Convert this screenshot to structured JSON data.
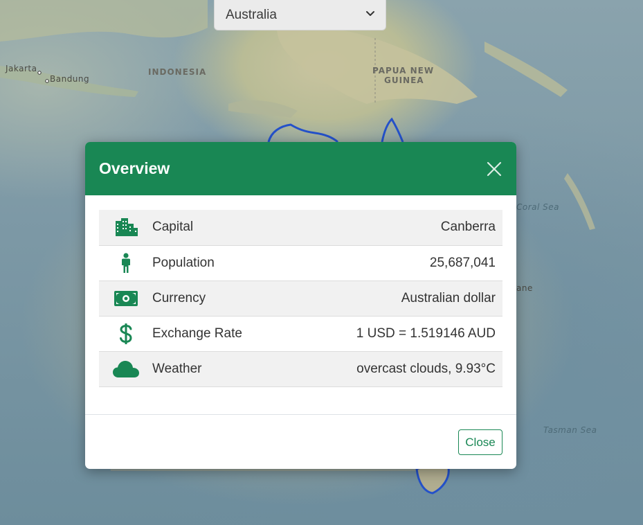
{
  "country_select": {
    "value": "Australia",
    "icon": "chevron-down-icon"
  },
  "map": {
    "labels": {
      "jakarta": "Jakarta",
      "bandung": "Bandung",
      "indonesia": "INDONESIA",
      "papua_line1": "PAPUA NEW",
      "papua_line2": "GUINEA",
      "coral_sea": "Coral Sea",
      "brisbane_partial": "ane",
      "tasman_sea": "Tasman Sea"
    }
  },
  "modal": {
    "title": "Overview",
    "close_icon": "close-icon",
    "rows": [
      {
        "icon": "city-icon",
        "label": "Capital",
        "value": "Canberra"
      },
      {
        "icon": "person-icon",
        "label": "Population",
        "value": "25,687,041"
      },
      {
        "icon": "banknote-icon",
        "label": "Currency",
        "value": "Australian dollar"
      },
      {
        "icon": "dollar-sign-icon",
        "label": "Exchange Rate",
        "value": "1 USD = 1.519146 AUD"
      },
      {
        "icon": "cloud-icon",
        "label": "Weather",
        "value": "overcast clouds, 9.93°C"
      }
    ],
    "close_button": "Close"
  },
  "colors": {
    "accent": "#198754",
    "border": "#2451c9"
  }
}
